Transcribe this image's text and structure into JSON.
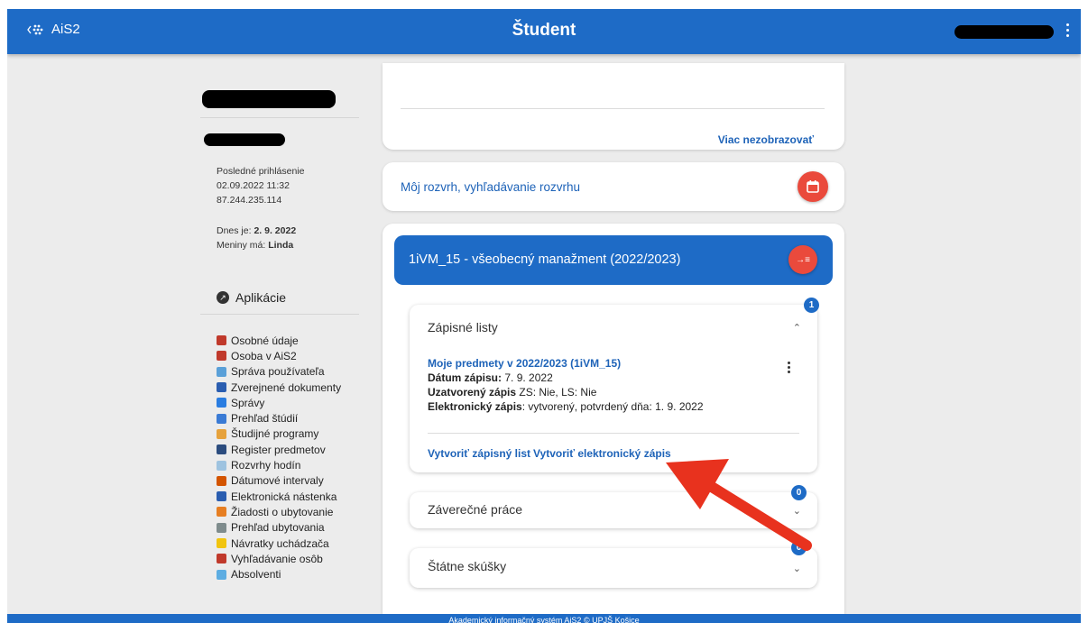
{
  "header": {
    "logo_text": "AiS2",
    "title": "Študent"
  },
  "sidebar": {
    "last_login_label": "Posledné prihlásenie",
    "last_login_time": "02.09.2022 11:32",
    "last_login_ip": "87.244.235.114",
    "today_label": "Dnes je:",
    "today_value": "2. 9. 2022",
    "nameday_label": "Meniny má:",
    "nameday_value": "Linda",
    "apps_title": "Aplikácie",
    "items": [
      {
        "label": "Osobné údaje",
        "icon": "person-icon",
        "color": "#c0392b"
      },
      {
        "label": "Osoba v AiS2",
        "icon": "person-icon",
        "color": "#c0392b"
      },
      {
        "label": "Správa používateľa",
        "icon": "org-chart-icon",
        "color": "#5aa0d8"
      },
      {
        "label": "Zverejnené dokumenty",
        "icon": "document-icon",
        "color": "#2a5db0"
      },
      {
        "label": "Správy",
        "icon": "message-icon",
        "color": "#2a7de1"
      },
      {
        "label": "Prehľad štúdií",
        "icon": "list-icon",
        "color": "#3a7bd5"
      },
      {
        "label": "Študijné programy",
        "icon": "list-icon",
        "color": "#e6a23c"
      },
      {
        "label": "Register predmetov",
        "icon": "register-icon",
        "color": "#2b4c7e"
      },
      {
        "label": "Rozvrhy hodín",
        "icon": "timetable-icon",
        "color": "#9ec3e0"
      },
      {
        "label": "Dátumové intervaly",
        "icon": "calendar-icon",
        "color": "#d35400"
      },
      {
        "label": "Elektronická nástenka",
        "icon": "board-icon",
        "color": "#2a5db0"
      },
      {
        "label": "Žiadosti o ubytovanie",
        "icon": "accommodation-icon",
        "color": "#e67e22"
      },
      {
        "label": "Prehľad ubytovania",
        "icon": "dots-grid-icon",
        "color": "#7f8c8d"
      },
      {
        "label": "Návratky uchádzača",
        "icon": "return-icon",
        "color": "#f1c40f"
      },
      {
        "label": "Vyhľadávanie osôb",
        "icon": "people-search-icon",
        "color": "#c0392b"
      },
      {
        "label": "Absolventi",
        "icon": "graduate-icon",
        "color": "#5dade2"
      }
    ]
  },
  "main": {
    "dont_show_more": "Viac nezobrazovať",
    "schedule_link": "Môj rozvrh, vyhľadávanie rozvrhu",
    "study_title": "1iVM_15 - všeobecný manažment (2022/2023)",
    "zapisne": {
      "title": "Zápisné listy",
      "badge": "1",
      "entry_title": "Moje predmety v 2022/2023 (1iVM_15)",
      "date_label": "Dátum zápisu:",
      "date_value": "7. 9. 2022",
      "closed_label": "Uzatvorený zápis",
      "closed_value": "ZS: Nie,  LS: Nie",
      "electronic_label": "Elektronický zápis",
      "electronic_value": ": vytvorený, potvrdený dňa: 1. 9. 2022",
      "action_create_list": "Vytvoriť zápisný list",
      "action_create_electronic": "Vytvoriť elektronický zápis"
    },
    "zaverecne": {
      "title": "Záverečné práce",
      "badge": "0"
    },
    "statne": {
      "title": "Štátne skúšky",
      "badge": "0"
    }
  },
  "footer": {
    "text": "Akademický informačný systém AiS2 © UPJŠ Košice"
  },
  "colors": {
    "primary": "#1e6bc6",
    "accent": "#ea4a3c",
    "annotation_arrow": "#e8321e"
  }
}
